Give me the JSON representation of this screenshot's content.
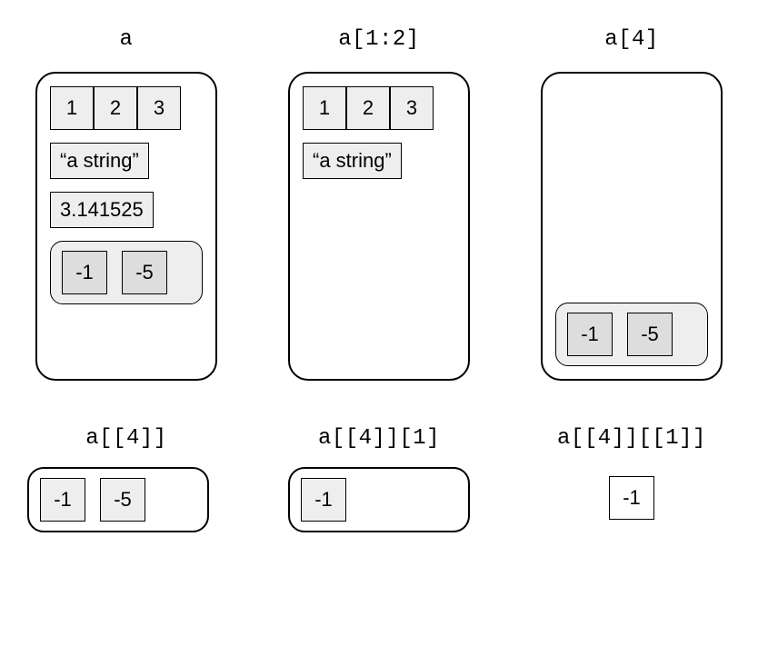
{
  "panels": {
    "a": {
      "caption": "a",
      "vec": [
        "1",
        "2",
        "3"
      ],
      "string": "“a string”",
      "num": "3.141525",
      "inner": [
        "-1",
        "-5"
      ]
    },
    "a_slice_12": {
      "caption": "a[1:2]",
      "vec": [
        "1",
        "2",
        "3"
      ],
      "string": "“a string”"
    },
    "a_sub_4": {
      "caption": "a[4]",
      "inner": [
        "-1",
        "-5"
      ]
    },
    "a_dd_4": {
      "caption": "a[[4]]",
      "cells": [
        "-1",
        "-5"
      ]
    },
    "a_dd4_1": {
      "caption": "a[[4]][1]",
      "cells": [
        "-1"
      ]
    },
    "a_dd4_dd1": {
      "caption": "a[[4]][[1]]",
      "cell": "-1"
    }
  }
}
